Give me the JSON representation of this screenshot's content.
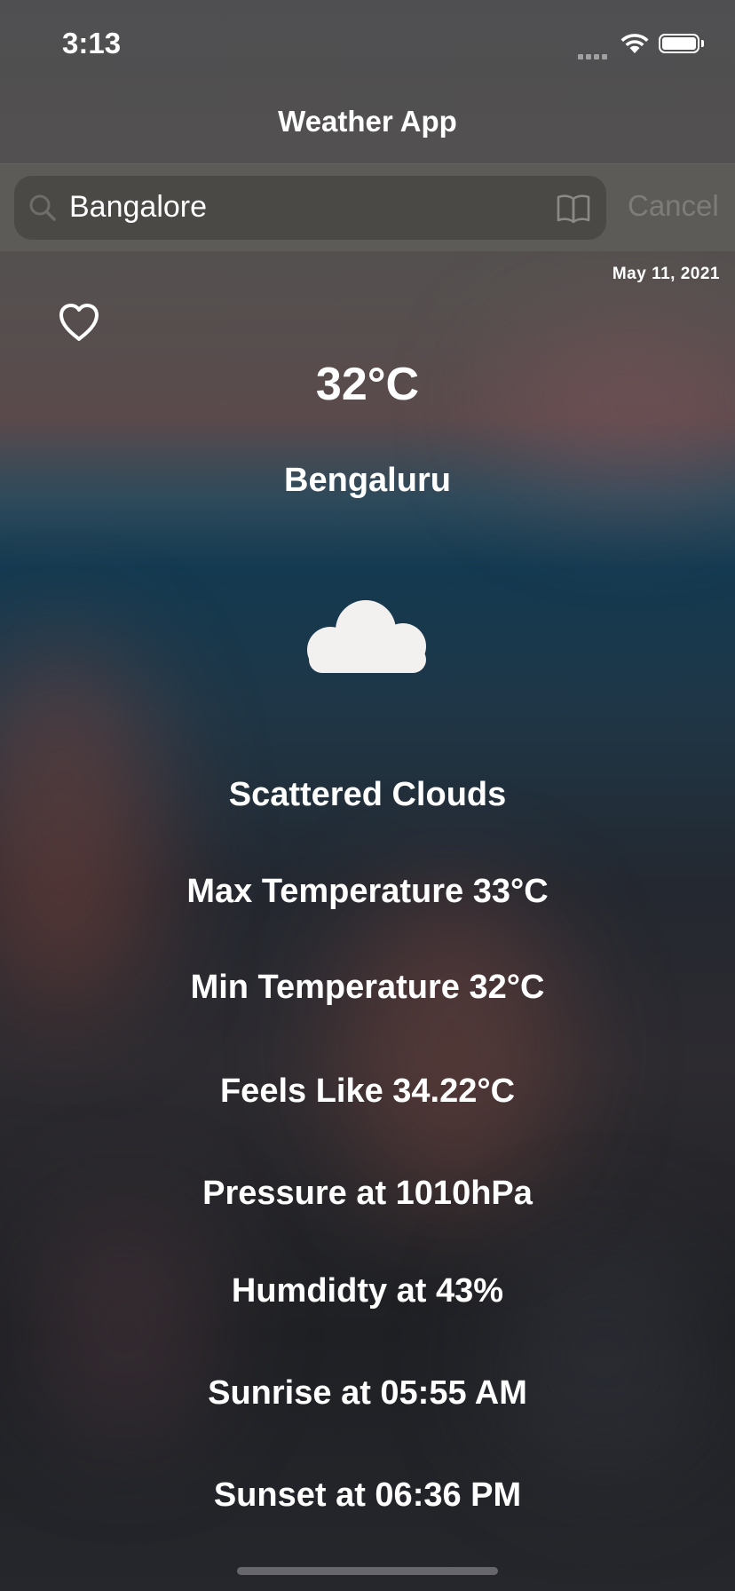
{
  "status_bar": {
    "time": "3:13"
  },
  "nav": {
    "title": "Weather App"
  },
  "search": {
    "value": "Bangalore",
    "cancel_label": "Cancel"
  },
  "weather": {
    "date": "May 11, 2021",
    "temperature": "32°C",
    "city": "Bengaluru",
    "icon": "cloud-icon",
    "description": "Scattered Clouds",
    "max_temperature": "Max Temperature 33°C",
    "min_temperature": "Min Temperature 32°C",
    "feels_like": "Feels Like 34.22°C",
    "pressure": "Pressure at 1010hPa",
    "humidity": "Humdidty at 43%",
    "sunrise": "Sunrise at 05:55 AM",
    "sunset": "Sunset at 06:36 PM"
  },
  "colors": {
    "search_bar_bg": "#5c5b58",
    "search_field_bg": "#4a4946",
    "cancel_text": "#7d7c78",
    "cloud": "#f2f1ef"
  }
}
